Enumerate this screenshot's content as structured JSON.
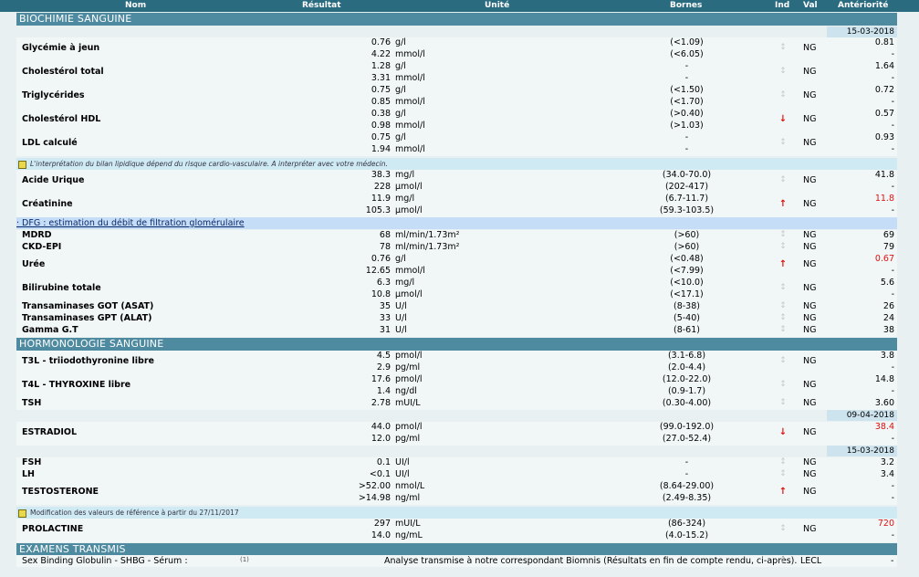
{
  "header": {
    "nom": "Nom",
    "resultat": "Résultat",
    "unite": "Unité",
    "bornes": "Bornes",
    "ind": "Ind",
    "val": "Val",
    "anteriorite": "Antériorité"
  },
  "sections": {
    "biochimie": "BIOCHIMIE SANGUINE",
    "hormono": "HORMONOLOGIE SANGUINE",
    "examens": "EXAMENS TRANSMIS"
  },
  "dates": {
    "d1": "15-03-2018",
    "d2": "09-04-2018",
    "d3": "15-03-2018"
  },
  "notes": {
    "lipid": "L'interprétation du bilan lipidique dépend du risque cardio-vasculaire. A interpréter avec votre médecin.",
    "dfg": "· DFG : estimation du débit de filtration glomérulaire",
    "ref": "Modification des valeurs de référence à partir du 27/11/2017"
  },
  "rows": [
    {
      "name": "Glycémie à jeun",
      "lines": [
        {
          "v": "0.76",
          "u": "g/l",
          "b": "(<1.09)",
          "a": "0.81"
        },
        {
          "v": "4.22",
          "u": "mmol/l",
          "b": "(<6.05)",
          "a": "-"
        }
      ],
      "ind": "neu",
      "val": "NG"
    },
    {
      "name": "Cholestérol total",
      "lines": [
        {
          "v": "1.28",
          "u": "g/l",
          "b": "-",
          "a": "1.64"
        },
        {
          "v": "3.31",
          "u": "mmol/l",
          "b": "-",
          "a": "-"
        }
      ],
      "ind": "neu",
      "val": "NG"
    },
    {
      "name": "Triglycérides",
      "lines": [
        {
          "v": "0.75",
          "u": "g/l",
          "b": "(<1.50)",
          "a": "0.72"
        },
        {
          "v": "0.85",
          "u": "mmol/l",
          "b": "(<1.70)",
          "a": "-"
        }
      ],
      "ind": "neu",
      "val": "NG"
    },
    {
      "name": "Cholestérol HDL",
      "lines": [
        {
          "v": "0.38",
          "u": "g/l",
          "b": "(>0.40)",
          "a": "0.57"
        },
        {
          "v": "0.98",
          "u": "mmol/l",
          "b": "(>1.03)",
          "a": "-"
        }
      ],
      "ind": "dn",
      "val": "NG"
    },
    {
      "name": "LDL calculé",
      "lines": [
        {
          "v": "0.75",
          "u": "g/l",
          "b": "-",
          "a": "0.93"
        },
        {
          "v": "1.94",
          "u": "mmol/l",
          "b": "-",
          "a": "-"
        }
      ],
      "ind": "neu",
      "val": "NG"
    },
    {
      "name": "Acide Urique",
      "lines": [
        {
          "v": "38.3",
          "u": "mg/l",
          "b": "(34.0-70.0)",
          "a": "41.8"
        },
        {
          "v": "228",
          "u": "µmol/l",
          "b": "(202-417)",
          "a": "-"
        }
      ],
      "ind": "neu",
      "val": "NG"
    },
    {
      "name": "Créatinine",
      "lines": [
        {
          "v": "11.9",
          "u": "mg/l",
          "b": "(6.7-11.7)",
          "a": "11.8",
          "ar": true
        },
        {
          "v": "105.3",
          "u": "µmol/l",
          "b": "(59.3-103.5)",
          "a": "-"
        }
      ],
      "ind": "up",
      "val": "NG"
    },
    {
      "name": "MDRD",
      "lines": [
        {
          "v": "68",
          "u": "ml/min/1.73m²",
          "b": "(>60)",
          "a": "69"
        }
      ],
      "ind": "neu",
      "val": "NG"
    },
    {
      "name": "CKD-EPI",
      "lines": [
        {
          "v": "78",
          "u": "ml/min/1.73m²",
          "b": "(>60)",
          "a": "79"
        }
      ],
      "ind": "neu",
      "val": "NG"
    },
    {
      "name": "Urée",
      "lines": [
        {
          "v": "0.76",
          "u": "g/l",
          "b": "(<0.48)",
          "a": "0.67",
          "ar": true
        },
        {
          "v": "12.65",
          "u": "mmol/l",
          "b": "(<7.99)",
          "a": "-"
        }
      ],
      "ind": "up",
      "val": "NG"
    },
    {
      "name": "Bilirubine totale",
      "lines": [
        {
          "v": "6.3",
          "u": "mg/l",
          "b": "(<10.0)",
          "a": "5.6"
        },
        {
          "v": "10.8",
          "u": "µmol/l",
          "b": "(<17.1)",
          "a": "-"
        }
      ],
      "ind": "neu",
      "val": "NG"
    },
    {
      "name": "Transaminases GOT (ASAT)",
      "lines": [
        {
          "v": "35",
          "u": "U/l",
          "b": "(8-38)",
          "a": "26"
        }
      ],
      "ind": "neu",
      "val": "NG"
    },
    {
      "name": "Transaminases GPT (ALAT)",
      "lines": [
        {
          "v": "33",
          "u": "U/l",
          "b": "(5-40)",
          "a": "24"
        }
      ],
      "ind": "neu",
      "val": "NG"
    },
    {
      "name": "Gamma G.T",
      "lines": [
        {
          "v": "31",
          "u": "U/l",
          "b": "(8-61)",
          "a": "38"
        }
      ],
      "ind": "neu",
      "val": "NG"
    },
    {
      "name": "T3L - triiodothyronine libre",
      "lines": [
        {
          "v": "4.5",
          "u": "pmol/l",
          "b": "(3.1-6.8)",
          "a": "3.8"
        },
        {
          "v": "2.9",
          "u": "pg/ml",
          "b": "(2.0-4.4)",
          "a": "-"
        }
      ],
      "ind": "neu",
      "val": "NG"
    },
    {
      "name": "T4L - THYROXINE libre",
      "lines": [
        {
          "v": "17.6",
          "u": "pmol/l",
          "b": "(12.0-22.0)",
          "a": "14.8"
        },
        {
          "v": "1.4",
          "u": "ng/dl",
          "b": "(0.9-1.7)",
          "a": "-"
        }
      ],
      "ind": "neu",
      "val": "NG"
    },
    {
      "name": "TSH",
      "lines": [
        {
          "v": "2.78",
          "u": "mUI/L",
          "b": "(0.30-4.00)",
          "a": "3.60"
        }
      ],
      "ind": "neu",
      "val": "NG"
    },
    {
      "name": "ESTRADIOL",
      "lines": [
        {
          "v": "44.0",
          "u": "pmol/l",
          "b": "(99.0-192.0)",
          "a": "38.4",
          "ar": true
        },
        {
          "v": "12.0",
          "u": "pg/ml",
          "b": "(27.0-52.4)",
          "a": "-"
        }
      ],
      "ind": "dn",
      "val": "NG"
    },
    {
      "name": "FSH",
      "lines": [
        {
          "v": "0.1",
          "u": "UI/l",
          "b": "-",
          "a": "3.2"
        }
      ],
      "ind": "neu",
      "val": "NG"
    },
    {
      "name": "LH",
      "lines": [
        {
          "v": "<0.1",
          "u": "UI/l",
          "b": "-",
          "a": "3.4"
        }
      ],
      "ind": "neu",
      "val": "NG"
    },
    {
      "name": "TESTOSTERONE",
      "lines": [
        {
          "v": ">52.00",
          "u": "nmol/L",
          "b": "(8.64-29.00)",
          "a": "-"
        },
        {
          "v": ">14.98",
          "u": "ng/ml",
          "b": "(2.49-8.35)",
          "a": "-"
        }
      ],
      "ind": "up",
      "val": "NG"
    },
    {
      "name": "PROLACTINE",
      "lines": [
        {
          "v": "297",
          "u": "mUI/L",
          "b": "(86-324)",
          "a": "720",
          "ar": true
        },
        {
          "v": "14.0",
          "u": "ng/mL",
          "b": "(4.0-15.2)",
          "a": "-"
        }
      ],
      "ind": "neu",
      "val": "NG"
    }
  ],
  "transmis": {
    "name": "Sex Binding Globulin - SHBG - Sérum :",
    "ref": "(1)",
    "text": "Analyse transmise à notre correspondant Biomnis (Résultats en fin de compte rendu, ci-après).",
    "val": "LECL",
    "ant": "-"
  },
  "icons": {
    "up": "↑",
    "dn": "↓",
    "neu": "↕"
  }
}
